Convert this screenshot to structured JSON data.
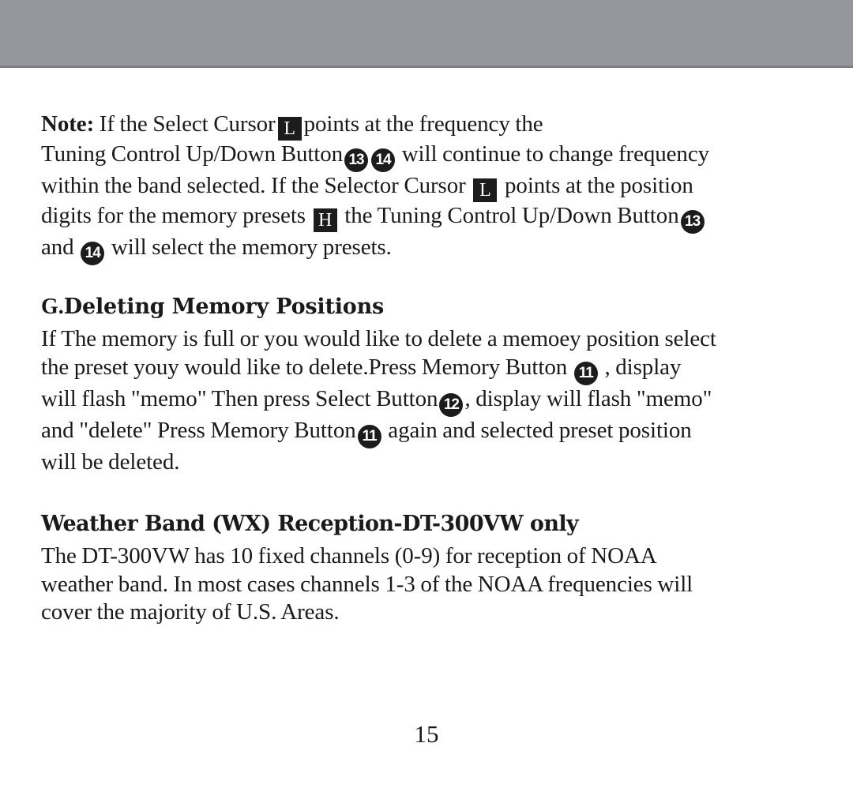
{
  "document": {
    "page_number": "15",
    "header_band_color": "#94969b",
    "text_color": "#1a1a1a",
    "badge_color": "#1c1c1c"
  },
  "note_paragraph": {
    "label": "Note:",
    "line1_a": "If the Select Cursor",
    "badge_L_1": "L",
    "line1_b": "points at the frequency the",
    "line2_a": "Tuning Control Up/Down Button",
    "badge_13_1": "13",
    "badge_14_1": "14",
    "line2_b": "will continue to change frequency",
    "line3_a": "within the band selected. If the Selector Cursor",
    "badge_L_2": "L",
    "line3_b": "points at the position",
    "line4_a": "digits for the memory presets",
    "badge_H": "H",
    "line4_b": "the Tuning Control Up/Down Button",
    "badge_13_2": "13",
    "line5_a": "and",
    "badge_14_2": "14",
    "line5_b": "will select the memory presets."
  },
  "section_g": {
    "letter": "G.",
    "title": "Deleting Memory Positions",
    "line1": "If The memory is full or you would like to delete a memoey position select",
    "line2_a": "the preset youy would like to delete.Press Memory Button",
    "badge_11_1": "11",
    "line2_b": ", display",
    "line3_a": "will flash  \"memo\"  Then press Select Button",
    "badge_12": "12",
    "line3_b": ", display will flash  \"memo\"",
    "line4_a": "and  \"delete\"  Press Memory Button",
    "badge_11_2": "11",
    "line4_b": "again and selected preset  position",
    "line5": "will be deleted."
  },
  "section_wx": {
    "title": "Weather Band (WX) Reception-DT-300VW only",
    "line1": "The DT-300VW has 10 fixed channels (0-9) for reception of NOAA",
    "line2": "weather band. In most cases channels 1-3 of the NOAA frequencies will",
    "line3": "cover the majority of U.S. Areas."
  }
}
